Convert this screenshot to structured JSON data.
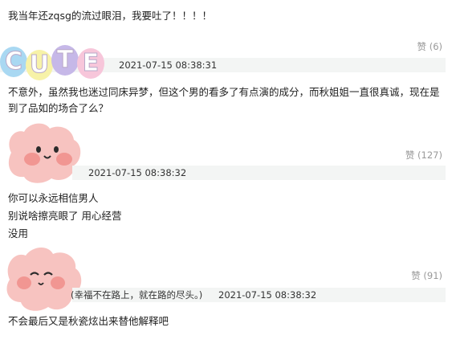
{
  "comments": [
    {
      "body": "我当年还zqsg的流过眼泪，我要吐了！！！！",
      "likes_label": "赞 (6)"
    },
    {
      "time": "2021-07-15 08:38:31",
      "body_line1": "不意外，虽然我也迷过同床异梦，但这个男的看多了有点演的成分，而秋姐姐一直很真诚，现在是",
      "body_line2": "到了品如的场合了么？",
      "likes_label": "赞 (127)"
    },
    {
      "time": "2021-07-15 08:38:32",
      "body_lines": [
        "你可以永远相信男人",
        "别说啥擦亮眼了 用心经营",
        "没用"
      ],
      "likes_label": "赞 (91)"
    },
    {
      "signature": "(幸福不在路上，就在路的尽头。)",
      "time": "2021-07-15 08:38:32",
      "body": "不会最后又是秋瓷炫出来替他解释吧"
    }
  ],
  "cute_avatar": {
    "letters": [
      "C",
      "U",
      "T",
      "E"
    ],
    "colors": [
      "#a9d8f2",
      "#f7f2a8",
      "#c6b8e8",
      "#f7c6da"
    ]
  },
  "colors": {
    "bar_bg": "#f3f5f4",
    "like_text": "#999999",
    "avatar_pink": "#f7b7b5",
    "cheek": "#f28a8a"
  }
}
